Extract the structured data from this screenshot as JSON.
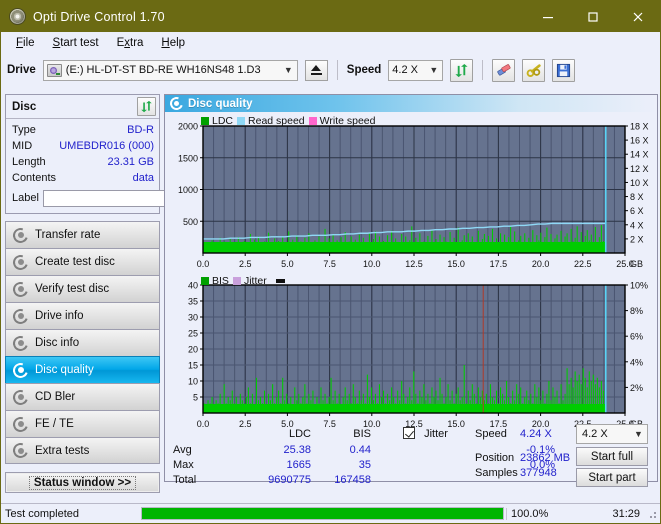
{
  "window": {
    "title": "Opti Drive Control 1.70",
    "icon": "disc-icon",
    "minimize": "minimize-icon",
    "maximize": "maximize-icon",
    "close": "close-icon"
  },
  "menu": {
    "items": [
      "File",
      "Start test",
      "Extra",
      "Help"
    ]
  },
  "toolbar": {
    "drive_label": "Drive",
    "drive_value": "(E:)  HL-DT-ST BD-RE  WH16NS48 1.D3",
    "eject": "eject-icon",
    "speed_label": "Speed",
    "speed_value": "4.2 X",
    "refresh": "refresh-icon",
    "erase": "eraser-icon",
    "tools": "tools-icon",
    "save": "save-icon"
  },
  "disc": {
    "header": "Disc",
    "refresh": "refresh-icon",
    "rows": [
      {
        "key": "Type",
        "value": "BD-R"
      },
      {
        "key": "MID",
        "value": "UMEBDR016 (000)"
      },
      {
        "key": "Length",
        "value": "23.31 GB"
      },
      {
        "key": "Contents",
        "value": "data"
      }
    ],
    "label_key": "Label",
    "label_value": "",
    "label_placeholder": ""
  },
  "nav": {
    "items": [
      {
        "label": "Transfer rate",
        "active": false
      },
      {
        "label": "Create test disc",
        "active": false
      },
      {
        "label": "Verify test disc",
        "active": false
      },
      {
        "label": "Drive info",
        "active": false
      },
      {
        "label": "Disc info",
        "active": false
      },
      {
        "label": "Disc quality",
        "active": true
      },
      {
        "label": "CD Bler",
        "active": false
      },
      {
        "label": "FE / TE",
        "active": false
      },
      {
        "label": "Extra tests",
        "active": false
      }
    ],
    "status_window": "Status window >>"
  },
  "panel": {
    "title": "Disc quality",
    "icon": "disc-quality-icon"
  },
  "stats": {
    "col_headers": [
      "LDC",
      "BIS"
    ],
    "rows": [
      {
        "key": "Avg",
        "ldc": "25.38",
        "bis": "0.44",
        "jitter": "-0.1%"
      },
      {
        "key": "Max",
        "ldc": "1665",
        "bis": "35",
        "jitter": "0.0%"
      },
      {
        "key": "Total",
        "ldc": "9690775",
        "bis": "167458",
        "jitter": ""
      }
    ],
    "jitter_label": "Jitter",
    "jitter_checked": true,
    "speed_label": "Speed",
    "speed_value": "4.24 X",
    "position_label": "Position",
    "position_value": "23862 MB",
    "samples_label": "Samples",
    "samples_value": "377948",
    "speed_select": "4.2 X",
    "start_full": "Start full",
    "start_part": "Start part"
  },
  "statusbar": {
    "text": "Test completed",
    "percent": "100.0%",
    "progress": 100,
    "time": "31:29"
  },
  "colors": {
    "titlebar": "#6b6a13",
    "ldc_green": "#00cc00",
    "bis_green": "#00cc00",
    "read_speed": "#8fd8f5",
    "write_speed": "#ff66cc",
    "jitter": "#c9a0dc",
    "plot_bg": "#66738f",
    "value_blue": "#2222cc",
    "progress_green": "#00b500",
    "accent": "#00a6e8"
  },
  "chart_data": [
    {
      "type": "line",
      "name": "disc-quality-ldc-chart",
      "title": "",
      "xlabel": "GB",
      "ylabel": "",
      "xlim": [
        0,
        25
      ],
      "ylim": [
        0,
        2000
      ],
      "xticks": [
        "0.0",
        "2.5",
        "5.0",
        "7.5",
        "10.0",
        "12.5",
        "15.0",
        "17.5",
        "20.0",
        "22.5",
        "25.0"
      ],
      "yticks": [
        "500",
        "1000",
        "1500",
        "2000"
      ],
      "y2lim": [
        0,
        18
      ],
      "y2ticks": [
        "2 X",
        "4 X",
        "6 X",
        "8 X",
        "10 X",
        "12 X",
        "14 X",
        "16 X",
        "18 X"
      ],
      "y2label": "X",
      "grid": true,
      "legend": [
        "LDC",
        "Read speed",
        "Write speed"
      ],
      "legend_position": "top-left",
      "series": [
        {
          "name": "LDC",
          "color": "#00cc00",
          "kind": "impulse",
          "values": [
            60,
            40,
            120,
            70,
            200,
            55,
            150,
            90,
            240,
            70,
            180,
            60,
            130,
            220,
            90,
            160,
            70,
            250,
            110,
            60,
            190,
            80,
            140,
            300,
            70,
            210,
            95,
            260,
            130,
            75,
            180,
            60,
            320,
            140,
            90,
            230,
            70,
            190,
            110,
            250,
            80,
            160,
            340,
            95,
            210,
            70,
            280,
            120,
            180,
            60,
            240,
            90,
            310,
            140,
            75,
            200,
            110,
            260,
            85,
            170,
            380,
            100,
            230,
            65,
            290,
            130,
            200,
            75,
            250,
            110,
            330,
            90,
            180,
            260,
            70,
            210,
            120,
            290,
            85,
            240,
            150,
            70,
            310,
            100,
            220,
            340,
            80,
            260,
            130,
            190,
            70,
            280,
            110,
            350,
            95,
            230,
            160,
            75,
            300,
            120,
            260,
            90,
            200,
            420,
            110,
            240,
            70,
            310,
            140,
            180,
            95,
            270,
            120,
            360,
            85,
            220,
            150,
            290,
            100,
            250,
            180,
            75,
            330,
            120,
            240,
            90,
            400,
            130,
            200,
            280,
            85,
            310,
            110,
            260,
            170,
            95,
            350,
            130,
            220,
            300,
            90,
            270,
            140,
            380,
            105,
            230,
            160,
            310,
            85,
            290,
            120,
            250,
            430,
            100,
            340,
            130,
            200,
            270,
            95,
            310,
            160,
            240,
            110,
            360,
            85,
            280,
            200,
            320,
            130,
            250,
            400,
            110,
            300,
            170,
            230,
            290,
            95,
            350,
            140,
            260,
            310,
            120,
            380,
            180,
            240,
            420,
            100,
            330,
            150,
            270,
            360,
            200,
            290,
            130,
            410,
            170,
            250,
            440,
            190,
            380
          ]
        },
        {
          "name": "Read speed",
          "color": "#8fd8f5",
          "kind": "line",
          "values": [
            2.0,
            2.0,
            2.0,
            2.0,
            2.1,
            2.1,
            2.1,
            2.2,
            2.2,
            2.2,
            2.3,
            2.3,
            2.3,
            2.4,
            2.4,
            2.4,
            2.5,
            2.5,
            2.5,
            2.6,
            2.6,
            2.7,
            2.7,
            2.8,
            2.8,
            2.9,
            2.9,
            3.0,
            3.0,
            3.0,
            3.1,
            3.1,
            3.2,
            3.2,
            3.3,
            3.3,
            3.4,
            3.4,
            3.5,
            3.5,
            3.6,
            3.6,
            3.7,
            3.7,
            3.8,
            3.8,
            3.9,
            3.9,
            4.0,
            4.1,
            4.1,
            4.2,
            4.2,
            4.2,
            4.2,
            4.2,
            4.2,
            4.2,
            4.2,
            4.2
          ]
        },
        {
          "name": "Write speed",
          "color": "#ff66cc",
          "kind": "line",
          "values": []
        }
      ],
      "markers": [
        {
          "type": "vline",
          "color": "#59d4f5",
          "x": 23.86
        }
      ]
    },
    {
      "type": "line",
      "name": "disc-quality-bis-chart",
      "title": "",
      "xlabel": "GB",
      "ylabel": "",
      "xlim": [
        0,
        25
      ],
      "ylim": [
        0,
        40
      ],
      "xticks": [
        "0.0",
        "2.5",
        "5.0",
        "7.5",
        "10.0",
        "12.5",
        "15.0",
        "17.5",
        "20.0",
        "22.5",
        "25.0"
      ],
      "yticks": [
        "5",
        "10",
        "15",
        "20",
        "25",
        "30",
        "35",
        "40"
      ],
      "y2lim": [
        0,
        10
      ],
      "y2ticks": [
        "2%",
        "4%",
        "6%",
        "8%",
        "10%"
      ],
      "grid": true,
      "legend": [
        "BIS",
        "Jitter"
      ],
      "legend_position": "top-left",
      "series": [
        {
          "name": "BIS",
          "color": "#00cc00",
          "kind": "impulse",
          "values": [
            3,
            2,
            4,
            3,
            5,
            2,
            4,
            3,
            6,
            2,
            9,
            3,
            5,
            4,
            7,
            3,
            5,
            2,
            6,
            4,
            3,
            5,
            8,
            3,
            6,
            2,
            11,
            4,
            5,
            3,
            7,
            2,
            6,
            4,
            9,
            3,
            5,
            7,
            3,
            11,
            4,
            6,
            3,
            5,
            2,
            8,
            4,
            6,
            3,
            5,
            9,
            3,
            6,
            4,
            7,
            2,
            5,
            3,
            8,
            4,
            6,
            3,
            5,
            11,
            4,
            7,
            3,
            6,
            2,
            5,
            8,
            4,
            6,
            3,
            9,
            5,
            3,
            7,
            4,
            6,
            3,
            12,
            5,
            8,
            4,
            6,
            3,
            9,
            5,
            7,
            3,
            6,
            4,
            8,
            5,
            3,
            7,
            4,
            10,
            6,
            3,
            5,
            8,
            4,
            13,
            6,
            3,
            7,
            5,
            9,
            4,
            6,
            3,
            8,
            5,
            7,
            4,
            11,
            6,
            3,
            5,
            9,
            4,
            7,
            3,
            6,
            8,
            4,
            5,
            15,
            3,
            7,
            4,
            9,
            6,
            3,
            8,
            5,
            7,
            4,
            6,
            3,
            9,
            5,
            4,
            7,
            3,
            8,
            6,
            4,
            10,
            5,
            3,
            7,
            4,
            9,
            6,
            8,
            3,
            5,
            7,
            4,
            6,
            3,
            9,
            5,
            8,
            4,
            7,
            3,
            6,
            10,
            4,
            8,
            5,
            7,
            3,
            9,
            4,
            6,
            14,
            9,
            11,
            8,
            13,
            10,
            12,
            9,
            14,
            11,
            8,
            13,
            10,
            12,
            9,
            11,
            8,
            10,
            7,
            9
          ]
        },
        {
          "name": "Jitter",
          "color": "#c9a0dc",
          "kind": "line",
          "values": []
        }
      ],
      "markers": [
        {
          "type": "vline",
          "color": "#59d4f5",
          "x": 23.86
        }
      ]
    }
  ]
}
